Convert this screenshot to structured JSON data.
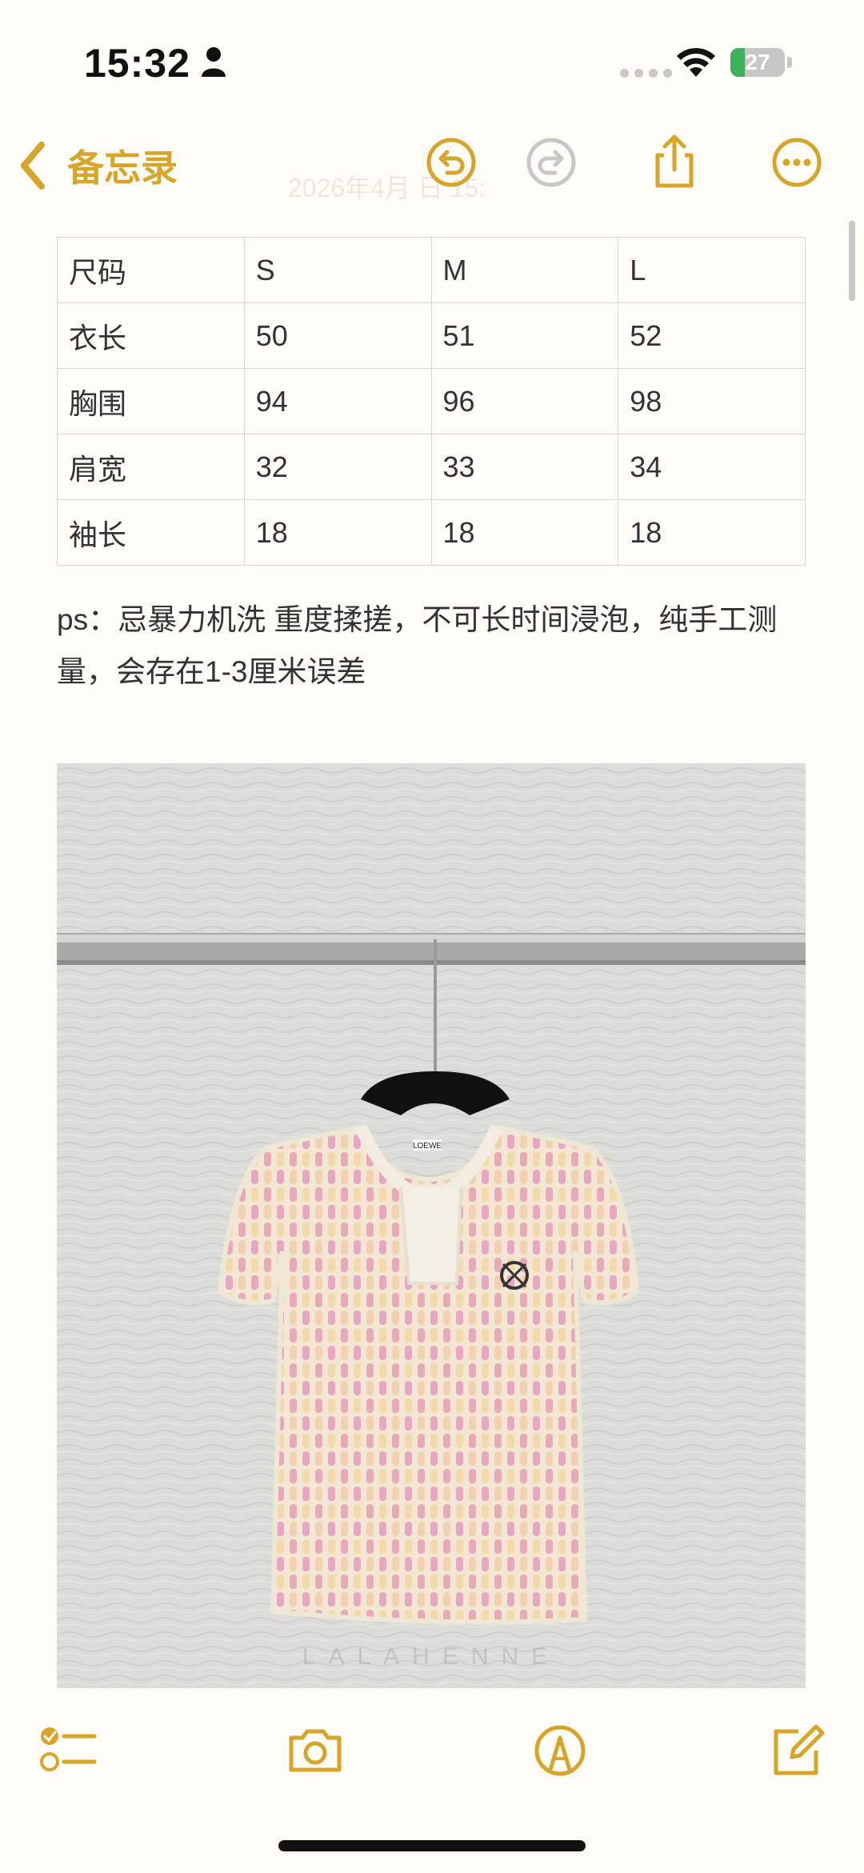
{
  "status_bar": {
    "time": "15:32",
    "battery_level": "27",
    "battery_fraction": 0.27
  },
  "nav": {
    "back_label": "备忘录",
    "date_text": "2026年4月  日 15:",
    "accent_color": "#d7a52a"
  },
  "size_table": {
    "rows": [
      [
        "尺码",
        "S",
        "M",
        "L"
      ],
      [
        "衣长",
        "50",
        "51",
        "52"
      ],
      [
        "胸围",
        "94",
        "96",
        "98"
      ],
      [
        "肩宽",
        "32",
        "33",
        "34"
      ],
      [
        "袖长",
        "18",
        "18",
        "18"
      ]
    ]
  },
  "note": {
    "text": "ps：忌暴力机洗 重度揉搓，不可长时间浸泡，纯手工测量，会存在1-3厘米误差"
  },
  "photo": {
    "watermark": "LALAHENNE",
    "label_text": "LOEWE",
    "description_colors": {
      "wall": "#d9d9d6",
      "rail": "#a4a4a2",
      "knit_pink": "#e9b3b8",
      "knit_cream": "#f4ead4"
    }
  },
  "toolbar": {
    "icons": [
      "checklist-icon",
      "camera-icon",
      "markup-icon",
      "compose-icon"
    ]
  }
}
